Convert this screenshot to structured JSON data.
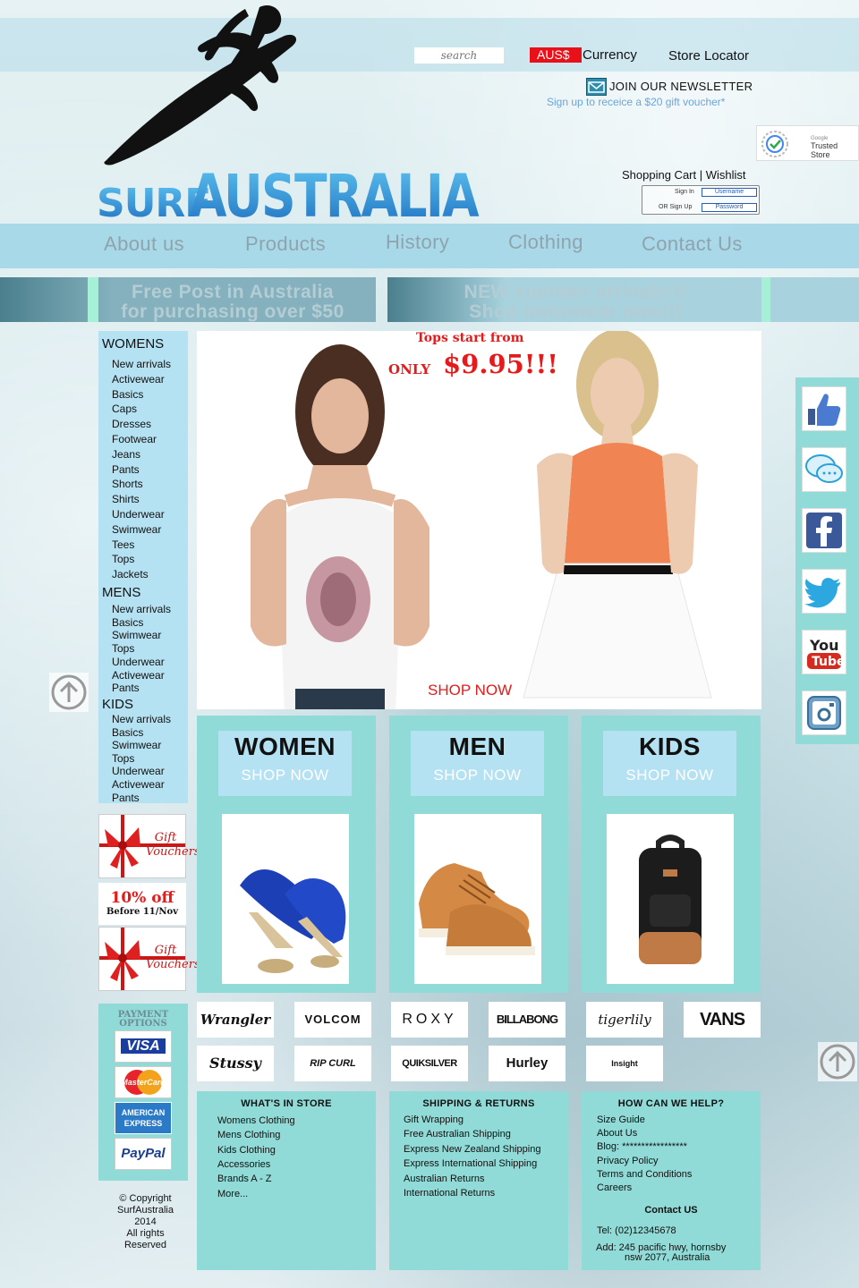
{
  "header": {
    "search_placeholder": "search",
    "currency_code": "AUS$",
    "currency_label": "Currency",
    "store_locator": "Store Locator",
    "newsletter_title": "JOIN OUR NEWSLETTER",
    "newsletter_sub": "Sign up to receice a $20 gift voucher*",
    "trusted_store": "Trusted Store",
    "trusted_store_small": "Google",
    "cart_links": "Shopping Cart | Wishlist",
    "sign_in": "Sign In",
    "sign_up": "OR Sign Up",
    "username": "Username",
    "password": "Password"
  },
  "nav": {
    "items": [
      "About us",
      "Products",
      "History",
      "Clothing",
      "Contact Us"
    ]
  },
  "promos": {
    "left_line1": "Free Post in Australia",
    "left_line2": "for purchasing over $50",
    "right_line1": "NEW summer arrivals!!!",
    "right_line2": "Shop swimwear now!!!"
  },
  "sidebar": {
    "women_title": "WOMENS",
    "women": [
      "New arrivals",
      "Activewear",
      "Basics",
      "Caps",
      "Dresses",
      "Footwear",
      "Jeans",
      "Pants",
      "Shorts",
      "Shirts",
      "Underwear",
      "Swimwear",
      "Tees",
      "Tops",
      "Jackets"
    ],
    "men_title": "MENS",
    "men": [
      "New arrivals",
      "Basics",
      "Swimwear",
      "Tops",
      "Underwear",
      "Activewear",
      "Pants"
    ],
    "kids_title": "KIDS",
    "kids": [
      "New arrivals",
      "Basics",
      "Swimwear",
      "Tops",
      "Underwear",
      "Activewear",
      "Pants"
    ],
    "gift_text": "Gift Vouchers",
    "discount": "10% off",
    "discount_sub": "Before 11/Nov"
  },
  "hero": {
    "tops_from": "Tops start from",
    "only": "ONLY",
    "price": "$9.95!!!",
    "cta": "SHOP NOW"
  },
  "categories": [
    {
      "title": "WOMEN",
      "cta": "SHOP NOW"
    },
    {
      "title": "MEN",
      "cta": "SHOP NOW"
    },
    {
      "title": "KIDS",
      "cta": "SHOP NOW"
    }
  ],
  "brands": [
    "Wrangler",
    "VOLCOM",
    "ROXY",
    "BILLABONG",
    "tigerlily",
    "VANS",
    "Stussy",
    "RIP CURL",
    "QUIKSILVER",
    "Hurley",
    "Insight"
  ],
  "payment": {
    "title1": "PAYMENT",
    "title2": "OPTIONS",
    "cards": [
      "VISA",
      "MasterCard",
      "AMERICAN EXPRESS",
      "PayPal"
    ]
  },
  "copyright": [
    "© Copyright",
    "SurfAustralia",
    "2014",
    "All rights",
    "Reserved"
  ],
  "footer": {
    "col1_title": "WHAT'S IN STORE",
    "col1": [
      "Womens Clothing",
      "Mens Clothing",
      "Kids Clothing",
      "Accessories",
      "Brands A - Z",
      "More..."
    ],
    "col2_title": "SHIPPING & RETURNS",
    "col2": [
      "Gift Wrapping",
      "Free Australian Shipping",
      "Express New Zealand Shipping",
      "Express International Shipping",
      "Australian Returns",
      "International Returns"
    ],
    "col3_title": "HOW CAN WE HELP?",
    "col3": [
      "Size Guide",
      "About Us",
      "Blog: *****************",
      "Privacy Policy",
      "Terms and Conditions",
      "Careers"
    ],
    "contact_title": "Contact US",
    "tel": "Tel: (02)12345678",
    "addr1": "Add: 245 pacific hwy, hornsby",
    "addr2": "nsw 2077, Australia"
  },
  "social": [
    "like-icon",
    "chat-icon",
    "facebook-icon",
    "twitter-icon",
    "youtube-icon",
    "instagram-icon"
  ],
  "colors": {
    "accent_teal": "#90dbd7",
    "light_blue": "#b5e2f2",
    "logo_blue": "#2d8fd6",
    "sale_red": "#e61a1a"
  }
}
